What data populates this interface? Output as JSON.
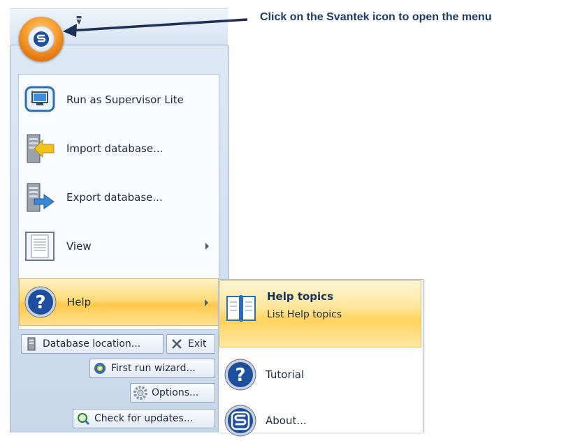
{
  "annotation": {
    "text": "Click on the Svantek icon to open the menu"
  },
  "orb": {
    "icon": "svantek-logo-icon"
  },
  "menu": {
    "items": [
      {
        "label": "Run as Supervisor Lite",
        "icon": "monitor-icon"
      },
      {
        "label": "Import database...",
        "icon": "import-database-icon"
      },
      {
        "label": "Export database...",
        "icon": "export-database-icon"
      },
      {
        "label": "View",
        "icon": "view-document-icon"
      },
      {
        "label": "Help",
        "icon": "help-icon"
      }
    ],
    "buttons": {
      "database_location": "Database location...",
      "exit": "Exit",
      "first_run_wizard": "First run wizard...",
      "options": "Options...",
      "check_updates": "Check for updates..."
    }
  },
  "help_submenu": {
    "topics_title": "Help topics",
    "topics_desc": "List Help topics",
    "tutorial": "Tutorial",
    "about": "About..."
  },
  "colors": {
    "highlight": "#ffd25c",
    "orb": "#f7a233",
    "annotation": "#1b3a6b"
  }
}
